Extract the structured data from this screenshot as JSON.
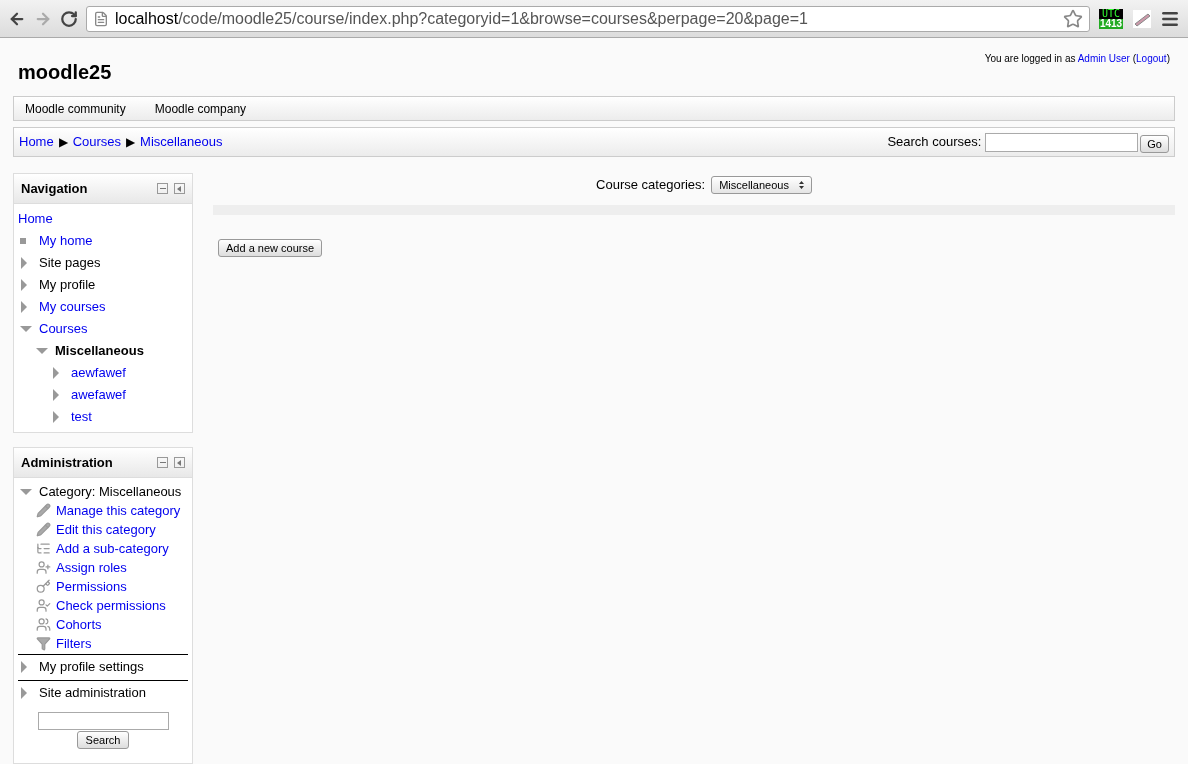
{
  "browser": {
    "url_host": "localhost",
    "url_path": "/code/moodle25/course/index.php?categoryid=1&browse=courses&perpage=20&page=1",
    "clock_label": "UTC",
    "clock_value": "1413"
  },
  "header": {
    "logged_in_text": "You are logged in as",
    "user": "Admin User",
    "logout_open": "(",
    "logout": "Logout",
    "logout_close": ")",
    "site_name": "moodle25"
  },
  "custom_menu": [
    "Moodle community",
    "Moodle company"
  ],
  "breadcrumb": {
    "items": [
      "Home",
      "Courses",
      "Miscellaneous"
    ],
    "separator": "▶"
  },
  "search": {
    "label": "Search courses:",
    "button": "Go"
  },
  "navigation": {
    "title": "Navigation",
    "items": [
      {
        "label": "Home",
        "kind": "plain",
        "link": true,
        "bold": false
      },
      {
        "label": "My home",
        "kind": "leaf",
        "link": true,
        "bold": false
      },
      {
        "label": "Site pages",
        "kind": "collapsed",
        "link": false,
        "bold": false
      },
      {
        "label": "My profile",
        "kind": "collapsed",
        "link": false,
        "bold": false
      },
      {
        "label": "My courses",
        "kind": "collapsed",
        "link": true,
        "bold": false
      },
      {
        "label": "Courses",
        "kind": "expanded",
        "link": true,
        "bold": false,
        "children": [
          {
            "label": "Miscellaneous",
            "kind": "expanded",
            "link": false,
            "bold": true,
            "children": [
              {
                "label": "aewfawef",
                "kind": "collapsed",
                "link": true,
                "bold": false
              },
              {
                "label": "awefawef",
                "kind": "collapsed",
                "link": true,
                "bold": false
              },
              {
                "label": "test",
                "kind": "collapsed",
                "link": true,
                "bold": false
              }
            ]
          }
        ]
      }
    ]
  },
  "administration": {
    "title": "Administration",
    "category": "Category: Miscellaneous",
    "links": [
      {
        "label": "Manage this category",
        "kind": "edit"
      },
      {
        "label": "Edit this category",
        "kind": "edit"
      },
      {
        "label": "Add a sub-category",
        "kind": "subcategory"
      },
      {
        "label": "Assign roles",
        "kind": "roles"
      },
      {
        "label": "Permissions",
        "kind": "permissions"
      },
      {
        "label": "Check permissions",
        "kind": "check"
      },
      {
        "label": "Cohorts",
        "kind": "cohorts"
      },
      {
        "label": "Filters",
        "kind": "filters"
      }
    ],
    "sections": [
      "My profile settings",
      "Site administration"
    ],
    "search_button": "Search"
  },
  "main": {
    "categories_label": "Course categories:",
    "category_value": "Miscellaneous",
    "add_button": "Add a new course"
  }
}
